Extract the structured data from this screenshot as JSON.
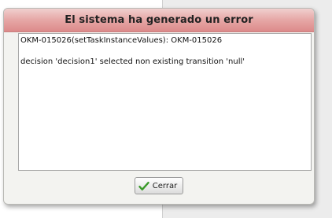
{
  "dialog": {
    "title": "El sistema ha generado un error",
    "message_lines": [
      "OKM-015026(setTaskInstanceValues): OKM-015026",
      "decision 'decision1' selected non existing transition 'null'"
    ],
    "close_button": {
      "label": "Cerrar",
      "icon": "checkmark-icon"
    }
  },
  "colors": {
    "title_bar": "#e1999a",
    "dialog_bg": "#f3f3f0",
    "checkmark": "#3a9a2a"
  }
}
